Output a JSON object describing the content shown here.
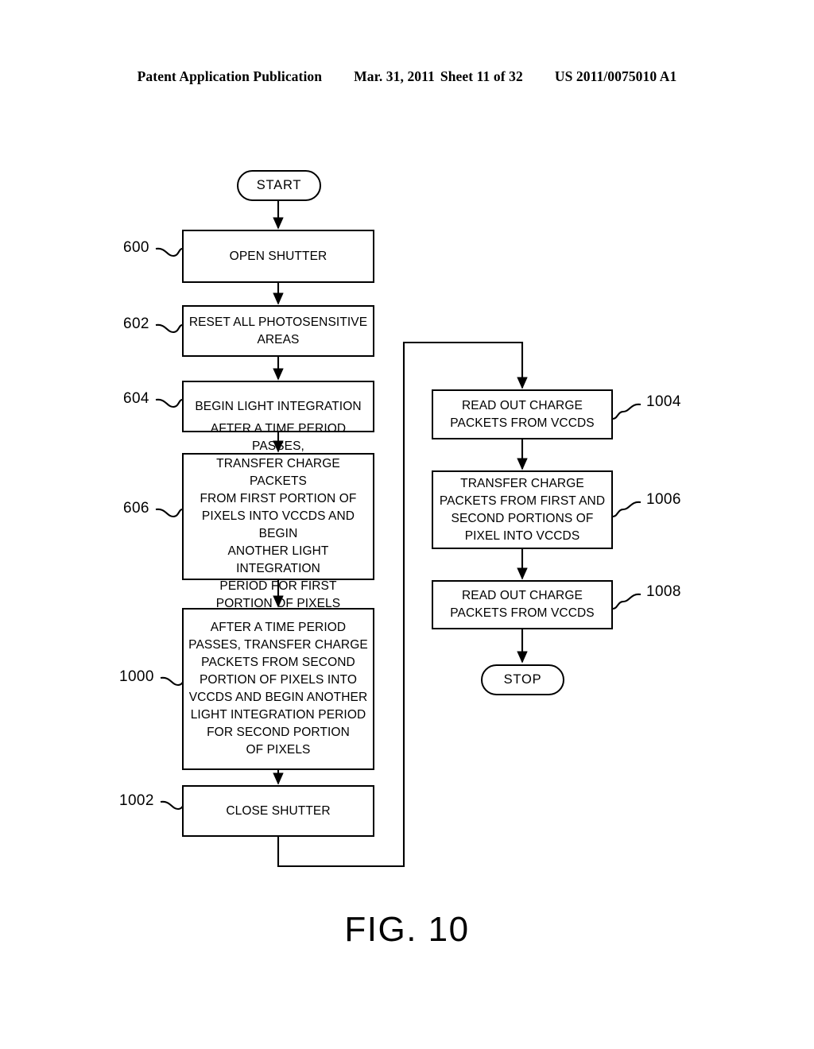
{
  "header": {
    "publication": "Patent Application Publication",
    "date": "Mar. 31, 2011",
    "sheet": "Sheet 11 of 32",
    "doc_number": "US 2011/0075010 A1"
  },
  "figure": {
    "caption": "FIG. 10"
  },
  "diagram": {
    "type": "flowchart",
    "nodes": {
      "start": {
        "label": "START",
        "shape": "terminator"
      },
      "n600": {
        "label": "OPEN SHUTTER",
        "shape": "process",
        "ref": "600"
      },
      "n602": {
        "label": "RESET ALL PHOTOSENSITIVE\nAREAS",
        "shape": "process",
        "ref": "602"
      },
      "n604": {
        "label": "BEGIN LIGHT INTEGRATION",
        "shape": "process",
        "ref": "604"
      },
      "n606": {
        "label": "AFTER A TIME PERIOD PASSES,\nTRANSFER CHARGE PACKETS\nFROM FIRST PORTION OF\nPIXELS INTO VCCDS AND BEGIN\nANOTHER LIGHT INTEGRATION\nPERIOD FOR FIRST\nPORTION OF PIXELS",
        "shape": "process",
        "ref": "606"
      },
      "n1000": {
        "label": "AFTER A TIME PERIOD\nPASSES, TRANSFER CHARGE\nPACKETS FROM SECOND\nPORTION OF PIXELS INTO\nVCCDS AND BEGIN ANOTHER\nLIGHT INTEGRATION PERIOD\nFOR SECOND PORTION\nOF PIXELS",
        "shape": "process",
        "ref": "1000"
      },
      "n1002": {
        "label": "CLOSE SHUTTER",
        "shape": "process",
        "ref": "1002"
      },
      "n1004": {
        "label": "READ OUT CHARGE\nPACKETS FROM VCCDS",
        "shape": "process",
        "ref": "1004"
      },
      "n1006": {
        "label": "TRANSFER CHARGE\nPACKETS FROM FIRST AND\nSECOND PORTIONS OF\nPIXEL  INTO VCCDS",
        "shape": "process",
        "ref": "1006"
      },
      "n1008": {
        "label": "READ OUT CHARGE\nPACKETS FROM VCCDS",
        "shape": "process",
        "ref": "1008"
      },
      "stop": {
        "label": "STOP",
        "shape": "terminator"
      }
    },
    "edges": [
      {
        "from": "start",
        "to": "n600"
      },
      {
        "from": "n600",
        "to": "n602"
      },
      {
        "from": "n602",
        "to": "n604"
      },
      {
        "from": "n604",
        "to": "n606"
      },
      {
        "from": "n606",
        "to": "n1000"
      },
      {
        "from": "n1000",
        "to": "n1002"
      },
      {
        "from": "n1002",
        "to": "n1004",
        "routing": "down-right-up-right-down"
      },
      {
        "from": "n1004",
        "to": "n1006"
      },
      {
        "from": "n1006",
        "to": "n1008"
      },
      {
        "from": "n1008",
        "to": "stop"
      }
    ]
  }
}
